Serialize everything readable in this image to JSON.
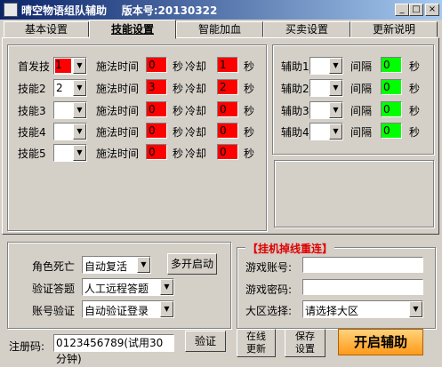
{
  "window": {
    "title": "晴空物语组队辅助",
    "version_label": "版本号:20130322",
    "min_glyph": "_",
    "max_glyph": "□",
    "close_glyph": "×"
  },
  "tabs": [
    "基本设置",
    "技能设置",
    "智能加血",
    "买卖设置",
    "更新说明"
  ],
  "skills": {
    "cast_label": "施法时间",
    "sec_label": "秒",
    "cooldown_label": "冷却",
    "rows": [
      {
        "label": "首发技",
        "key": "1",
        "cast": "0",
        "cooldown": "1"
      },
      {
        "label": "技能2",
        "key": "2",
        "cast": "3",
        "cooldown": "2"
      },
      {
        "label": "技能3",
        "key": "",
        "cast": "0",
        "cooldown": "0"
      },
      {
        "label": "技能4",
        "key": "",
        "cast": "0",
        "cooldown": "0"
      },
      {
        "label": "技能5",
        "key": "",
        "cast": "0",
        "cooldown": "0"
      }
    ]
  },
  "assist": {
    "interval_label": "间隔",
    "sec_label": "秒",
    "rows": [
      {
        "label": "辅助1",
        "key": "",
        "interval": "0"
      },
      {
        "label": "辅助2",
        "key": "",
        "interval": "0"
      },
      {
        "label": "辅助3",
        "key": "",
        "interval": "0"
      },
      {
        "label": "辅助4",
        "key": "",
        "interval": "0"
      }
    ]
  },
  "options": {
    "death_label": "角色死亡",
    "death_value": "自动复活",
    "captcha_label": "验证答题",
    "captcha_value": "人工远程答题",
    "account_label": "账号验证",
    "account_value": "自动验证登录",
    "multi_button": "多开启动"
  },
  "reconnect": {
    "title": "【挂机掉线重连】",
    "account_label": "游戏账号:",
    "password_label": "游戏密码:",
    "region_label": "大区选择:",
    "region_value": "请选择大区",
    "account_value": "",
    "password_value": ""
  },
  "register": {
    "label": "注册码:",
    "code": "0123456789(试用30分钟)",
    "verify_button": "验证"
  },
  "buttons": {
    "online_update": "在线更新",
    "save_settings": "保存设置",
    "start": "开启辅助"
  }
}
